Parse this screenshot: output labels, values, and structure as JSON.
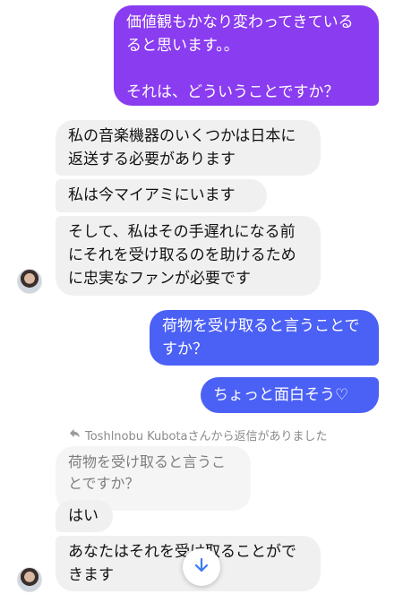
{
  "messages": {
    "m1": "価値観もかなり変わってきているると思います。。\n\nそれは、どういうことですか？",
    "m2": "私の音楽機器のいくつかは日本に返送する必要があります",
    "m3": "私は今マイアミにいます",
    "m4": "そして、私はその手遅れになる前にそれを受け取るのを助けるために忠実なファンが必要です",
    "m5": "荷物を受け取ると言うことですか？",
    "m6": "ちょっと面白そう♡",
    "reply_note": "Toshlnobu Kubotaさんから返信がありました",
    "quoted": "荷物を受け取ると言うことですか？",
    "m7": "はい",
    "m8": "あなたはそれを受け取ることができます"
  },
  "colors": {
    "purple": "#8a3cf0",
    "blue": "#4b60f4",
    "incoming": "#f0f0f0"
  },
  "icons": {
    "reply": "reply-arrow-icon",
    "scroll": "arrow-down-icon"
  }
}
